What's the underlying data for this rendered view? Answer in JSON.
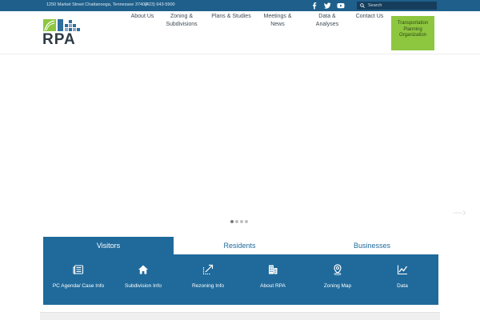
{
  "topbar": {
    "address": "1250 Market Street Chattanooga, Tennessee 37402",
    "phone": "(423) 643-5900",
    "social": [
      {
        "icon": "facebook-icon"
      },
      {
        "icon": "twitter-icon"
      },
      {
        "icon": "youtube-icon"
      }
    ],
    "search": {
      "placeholder": "Search",
      "value": ""
    }
  },
  "header": {
    "logo_text": "RPA",
    "nav": [
      {
        "label": "About Us"
      },
      {
        "label": "Zoning & Subdivisions"
      },
      {
        "label": "Plans & Studies"
      },
      {
        "label": "Meetings & News"
      },
      {
        "label": "Data & Analyses"
      },
      {
        "label": "Contact Us"
      }
    ],
    "tpo_button": "Transportation Planning Organization"
  },
  "slider": {
    "slide_count": 4,
    "active_index": 0
  },
  "audience_tabs": [
    {
      "label": "Visitors"
    },
    {
      "label": "Residents"
    },
    {
      "label": "Businesses"
    }
  ],
  "quick_links": [
    {
      "label": "PC Agenda/ Case Info",
      "icon": "newspaper-icon"
    },
    {
      "label": "Subdivision Info",
      "icon": "home-icon"
    },
    {
      "label": "Rezoning Info",
      "icon": "resize-icon"
    },
    {
      "label": "About RPA",
      "icon": "building-icon"
    },
    {
      "label": "Zoning Map",
      "icon": "map-pin-icon"
    },
    {
      "label": "Data",
      "icon": "line-chart-icon"
    }
  ],
  "colors": {
    "topbar": "#1f5f8b",
    "primary_blue": "#1f6a9b",
    "tpo_green": "#8dc63f",
    "text_dark": "#3e4a55"
  }
}
